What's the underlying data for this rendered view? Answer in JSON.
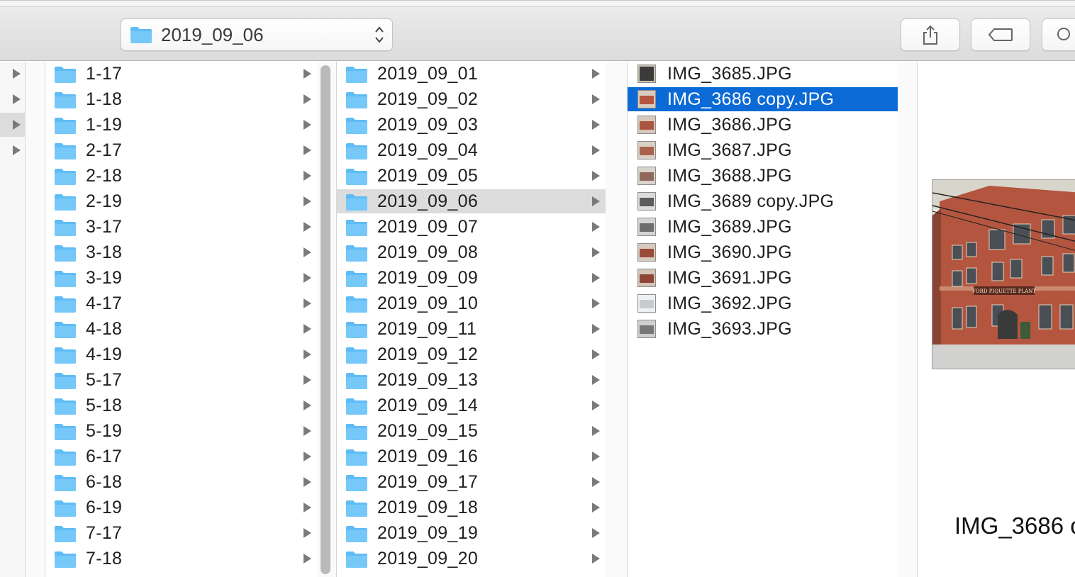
{
  "toolbar": {
    "path_label": "2019_09_06",
    "share_icon": "share-icon",
    "tag_icon": "tag-icon",
    "search_icon": "search-icon"
  },
  "column0": {
    "rows": 4,
    "selected_index": 2
  },
  "column1": {
    "items": [
      "1-17",
      "1-18",
      "1-19",
      "2-17",
      "2-18",
      "2-19",
      "3-17",
      "3-18",
      "3-19",
      "4-17",
      "4-18",
      "4-19",
      "5-17",
      "5-18",
      "5-19",
      "6-17",
      "6-18",
      "6-19",
      "7-17",
      "7-18"
    ]
  },
  "column2": {
    "items": [
      "2019_09_01",
      "2019_09_02",
      "2019_09_03",
      "2019_09_04",
      "2019_09_05",
      "2019_09_06",
      "2019_09_07",
      "2019_09_08",
      "2019_09_09",
      "2019_09_10",
      "2019_09_11",
      "2019_09_12",
      "2019_09_13",
      "2019_09_14",
      "2019_09_15",
      "2019_09_16",
      "2019_09_17",
      "2019_09_18",
      "2019_09_19",
      "2019_09_20"
    ],
    "selected": "2019_09_06"
  },
  "column3": {
    "files": [
      "IMG_3685.JPG",
      "IMG_3686 copy.JPG",
      "IMG_3686.JPG",
      "IMG_3687.JPG",
      "IMG_3688.JPG",
      "IMG_3689 copy.JPG",
      "IMG_3689.JPG",
      "IMG_3690.JPG",
      "IMG_3691.JPG",
      "IMG_3692.JPG",
      "IMG_3693.JPG"
    ],
    "selected": "IMG_3686 copy.JPG"
  },
  "preview": {
    "filename": "IMG_3686 c",
    "sign_text": "FORD PIQUETTE PLANT"
  },
  "colors": {
    "selection_blue": "#0b6ad6",
    "selection_gray": "#dcdcdc",
    "folder_blue": "#5ebcf6"
  }
}
